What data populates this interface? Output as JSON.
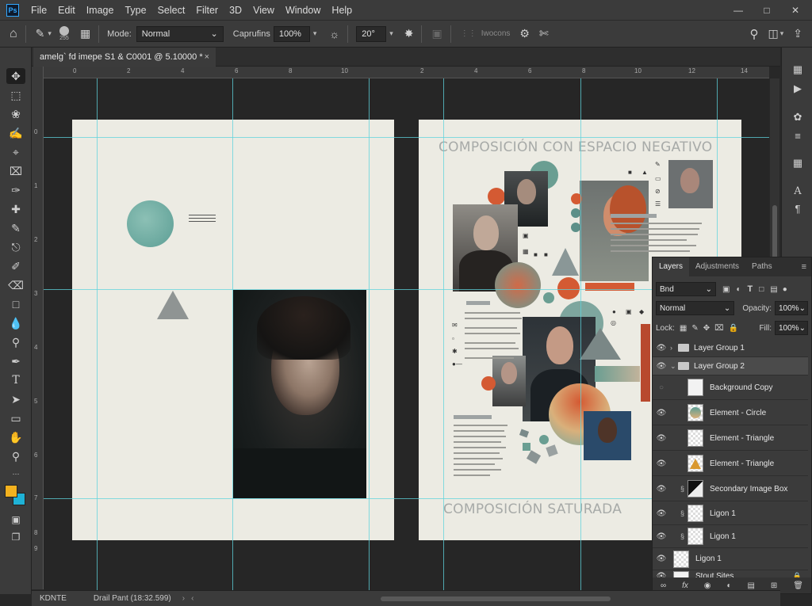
{
  "menu": [
    "File",
    "Edit",
    "Image",
    "Type",
    "Select",
    "Filter",
    "3D",
    "View",
    "Window",
    "Help"
  ],
  "app_logo": "Ps",
  "options": {
    "brush_size": "255",
    "mode_label": "Mode:",
    "mode_value": "Normal",
    "opacity_label": "Caprufins",
    "opacity_value": "100%",
    "angle_value": "20°",
    "extra_label": "Iwocons"
  },
  "document_tab": {
    "title": "amelg` fd imepe S1 & C0001 @ 5.10000 *",
    "close": "×"
  },
  "rulers": {
    "top": [
      "0",
      "2",
      "4",
      "6",
      "8",
      "10",
      "2",
      "4",
      "6",
      "8",
      "10",
      "12",
      "14",
      "16"
    ],
    "left": [
      "0",
      "1",
      "2",
      "3",
      "4",
      "5",
      "6",
      "7",
      "8",
      "9"
    ]
  },
  "canvas": {
    "heading_top": "COMPOSICIÓN CON ESPACIO NEGATIVO",
    "heading_bottom": "COMPOSICIÓN SATURADA"
  },
  "colors": {
    "foreground": "#f3b21f",
    "background": "#1fb2d6",
    "teal": "#5c9e95",
    "orange": "#d8582f",
    "page": "#ecebe3",
    "guide": "#5fd3dc"
  },
  "layers_panel": {
    "tabs": [
      "Layers",
      "Adjustments",
      "Paths"
    ],
    "filter_value": "Bnd",
    "blend_mode": "Normal",
    "opacity_label": "Opacity:",
    "opacity_value": "100%",
    "lock_label": "Lock:",
    "fill_label": "Fill:",
    "fill_value": "100%",
    "layers": [
      {
        "name": "Layer Group 1",
        "type": "group"
      },
      {
        "name": "Layer Group 2",
        "type": "group"
      },
      {
        "name": "Background Copy",
        "type": "layer"
      },
      {
        "name": "Element - Circle",
        "type": "layer"
      },
      {
        "name": "Element - Triangle",
        "type": "layer"
      },
      {
        "name": "Element - Triangle",
        "type": "layer"
      },
      {
        "name": "Secondary Image Box",
        "type": "layer"
      },
      {
        "name": "Ligon 1",
        "type": "layer"
      },
      {
        "name": "Ligon 1",
        "type": "layer"
      },
      {
        "name": "Ligon 1",
        "type": "layer"
      },
      {
        "name": "Stout Sites",
        "type": "layer"
      }
    ],
    "footer_icons": [
      "link-icon",
      "fx-icon",
      "mask-icon",
      "adjustment-icon",
      "folder-icon",
      "new-layer-icon",
      "trash-icon"
    ]
  },
  "status": {
    "left": "KDNTE",
    "info": "Drail Pant (18:32.599)"
  }
}
